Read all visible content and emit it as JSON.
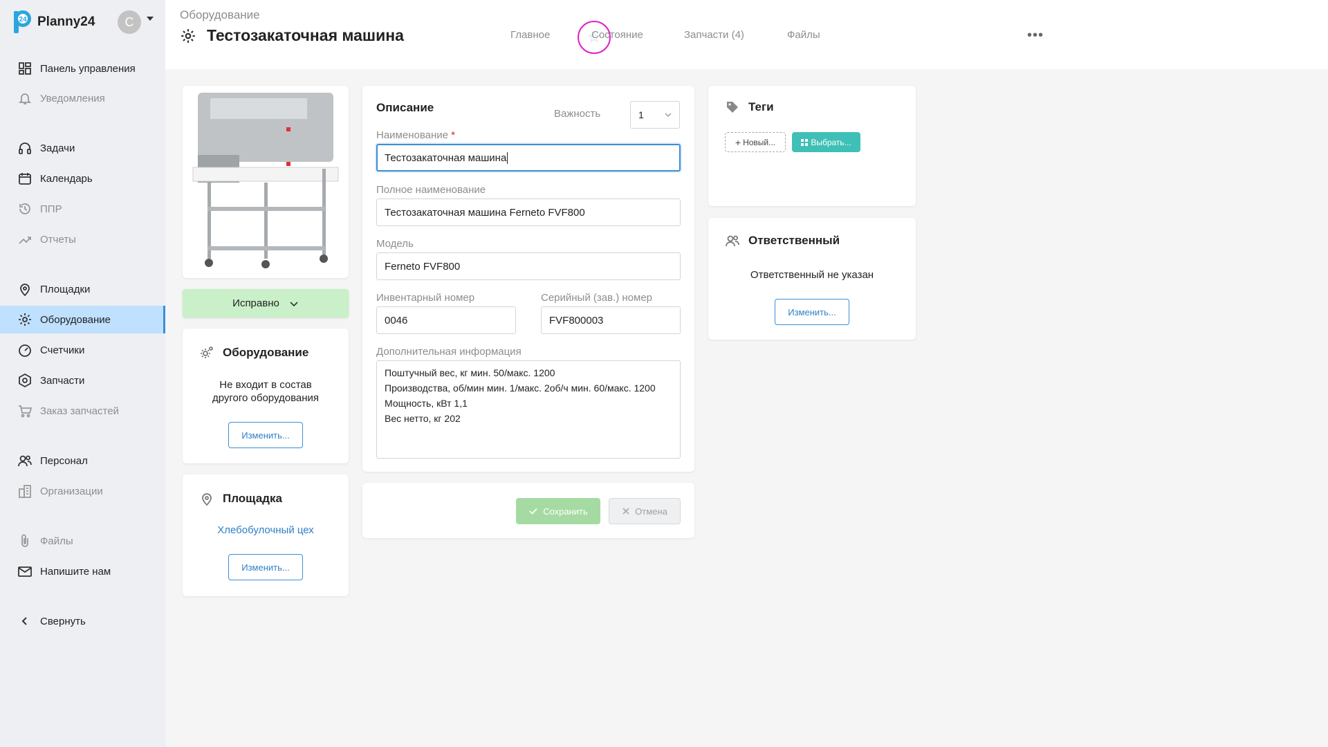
{
  "brand": {
    "name": "Planny24",
    "logo_text": "24"
  },
  "user": {
    "avatar_letter": "C"
  },
  "sidebar": {
    "items": [
      {
        "label": "Панель управления",
        "icon": "dashboard-icon"
      },
      {
        "label": "Уведомления",
        "icon": "bell-icon"
      },
      {
        "label": "Задачи",
        "icon": "headset-icon"
      },
      {
        "label": "Календарь",
        "icon": "calendar-icon"
      },
      {
        "label": "ППР",
        "icon": "history-icon"
      },
      {
        "label": "Отчеты",
        "icon": "trend-icon"
      },
      {
        "label": "Площадки",
        "icon": "location-icon"
      },
      {
        "label": "Оборудование",
        "icon": "gear-icon"
      },
      {
        "label": "Счетчики",
        "icon": "gauge-icon"
      },
      {
        "label": "Запчасти",
        "icon": "part-icon"
      },
      {
        "label": "Заказ запчастей",
        "icon": "cart-icon"
      },
      {
        "label": "Персонал",
        "icon": "people-icon"
      },
      {
        "label": "Организации",
        "icon": "building-icon"
      },
      {
        "label": "Файлы",
        "icon": "paperclip-icon"
      },
      {
        "label": "Напишите нам",
        "icon": "mail-icon"
      },
      {
        "label": "Свернуть",
        "icon": "chevron-left-icon"
      }
    ]
  },
  "header": {
    "breadcrumb": "Оборудование",
    "title": "Тестозакаточная машина",
    "tabs": [
      "Главное",
      "Состояние",
      "Запчасти (4)",
      "Файлы"
    ],
    "more": "•••"
  },
  "status": {
    "label": "Исправно"
  },
  "parent_card": {
    "title": "Оборудование",
    "text_line1": "Не входит в состав",
    "text_line2": "другого оборудования",
    "button": "Изменить..."
  },
  "site_card": {
    "title": "Площадка",
    "link": "Хлебобулочный цех",
    "button": "Изменить..."
  },
  "description": {
    "title": "Описание",
    "importance_label": "Важность",
    "importance_value": "1",
    "name_label": "Наименование",
    "required_mark": "*",
    "name_value": "Тестозакаточная машина",
    "full_name_label": "Полное наименование",
    "full_name_value": "Тестозакаточная машина Ferneto FVF800",
    "model_label": "Модель",
    "model_value": "Ferneto FVF800",
    "inventory_label": "Инвентарный номер",
    "inventory_value": "0046",
    "serial_label": "Серийный (зав.) номер",
    "serial_value": "FVF800003",
    "extra_label": "Дополнительная информация",
    "extra_lines": [
      "Поштучный вес, кг мин. 50/макс. 1200",
      "Производства, об/мин мин. 1/макс. 2об/ч мин. 60/макс. 1200",
      "Мощность, кВт 1,1",
      "Вес нетто, кг 202"
    ]
  },
  "actions": {
    "save": "Сохранить",
    "cancel": "Отмена"
  },
  "tags_card": {
    "title": "Теги",
    "new_button": "Новый...",
    "choose_button": "Выбрать..."
  },
  "responsible_card": {
    "title": "Ответственный",
    "text": "Ответственный не указан",
    "button": "Изменить..."
  },
  "colors": {
    "accent": "#3a8ed6",
    "active_nav": "#bfe0ff",
    "status_ok": "#c9f0c8",
    "teal": "#3fc0b6",
    "favorite_ring": "#e020c8"
  }
}
